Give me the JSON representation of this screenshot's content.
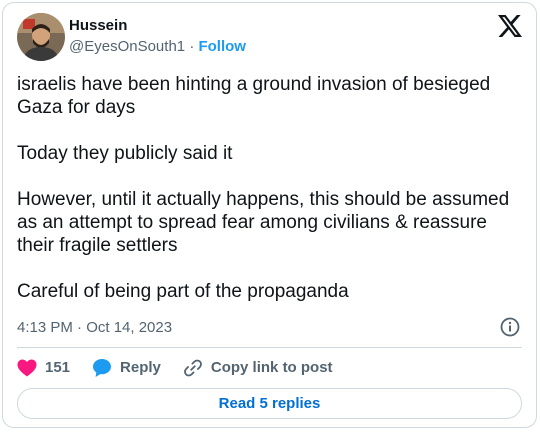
{
  "author": {
    "name": "Hussein",
    "handle": "@EyesOnSouth1",
    "separator": "·",
    "follow_label": "Follow"
  },
  "tweet": {
    "paragraphs": [
      "israelis have been hinting a ground invasion of besieged Gaza for days",
      "Today they publicly said it",
      "However, until it actually happens, this should be assumed as an attempt to spread fear among civilians & reassure their fragile settlers",
      "Careful of being part of the propaganda"
    ],
    "timestamp": "4:13 PM · Oct 14, 2023"
  },
  "actions": {
    "like_count": "151",
    "reply_label": "Reply",
    "copy_link_label": "Copy link to post"
  },
  "read_replies_label": "Read 5 replies",
  "icons": {
    "logo": "x-logo-icon",
    "info": "info-icon",
    "like": "heart-icon",
    "reply": "speech-bubble-icon",
    "copy": "link-icon"
  },
  "colors": {
    "accent": "#1d9bf0",
    "like": "#f91880",
    "text": "#0f1419",
    "muted": "#536471",
    "border": "#cfd9de"
  }
}
